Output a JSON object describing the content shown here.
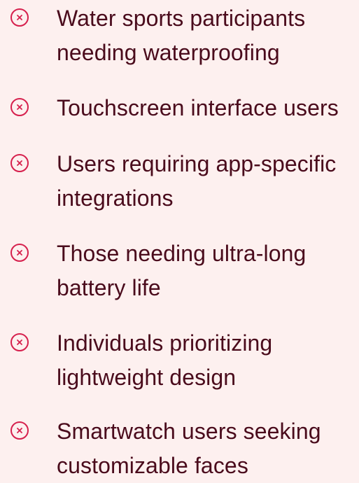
{
  "colors": {
    "background": "#fdf0ef",
    "text": "#4a0b1c",
    "icon": "#d6204d"
  },
  "items": [
    {
      "label": "Water sports participants needing waterproofing",
      "icon": "close-circle-icon"
    },
    {
      "label": "Touchscreen interface users",
      "icon": "close-circle-icon"
    },
    {
      "label": "Users requiring app-specific integrations",
      "icon": "close-circle-icon"
    },
    {
      "label": "Those needing ultra-long battery life",
      "icon": "close-circle-icon"
    },
    {
      "label": "Individuals prioritizing lightweight design",
      "icon": "close-circle-icon"
    },
    {
      "label": "Smartwatch users seeking customizable faces",
      "icon": "close-circle-icon"
    }
  ]
}
